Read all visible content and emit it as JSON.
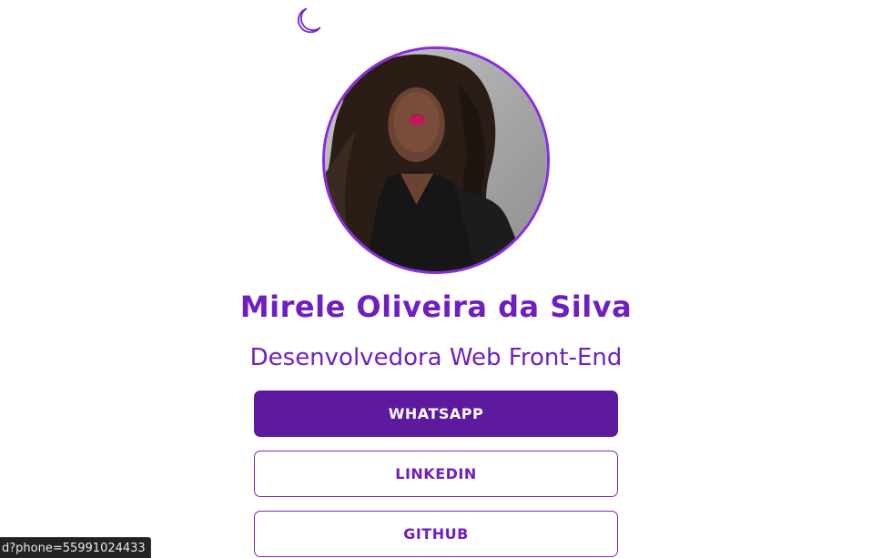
{
  "theme_toggle": {
    "icon": "moon-icon",
    "color": "#7b2bd1"
  },
  "profile": {
    "name": "Mirele Oliveira da Silva",
    "role": "Desenvolvedora Web Front-End",
    "accent_color": "#6f1fc0"
  },
  "links": [
    {
      "label": "WHATSAPP",
      "style": "filled"
    },
    {
      "label": "LINKEDIN",
      "style": "outline"
    },
    {
      "label": "GITHUB",
      "style": "outline"
    }
  ],
  "status_bar": {
    "url": "d?phone=55991024433"
  }
}
